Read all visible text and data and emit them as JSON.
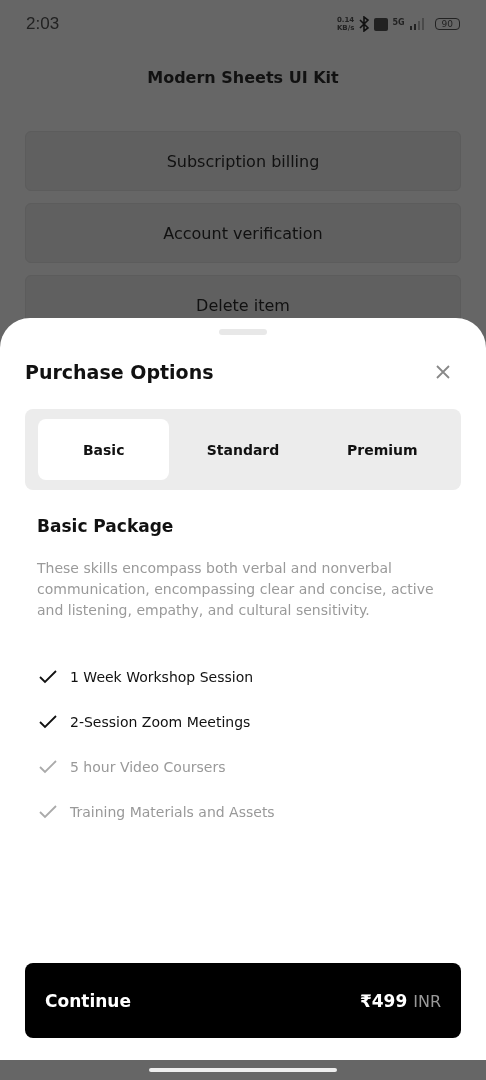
{
  "status_bar": {
    "time": "2:03",
    "speed": "0.14",
    "speed_unit": "KB/s",
    "network": "5G",
    "battery": "90"
  },
  "page": {
    "title": "Modern Sheets UI Kit",
    "items": [
      "Subscription billing",
      "Account verification",
      "Delete item"
    ]
  },
  "sheet": {
    "title": "Purchase Options",
    "tabs": [
      {
        "label": "Basic",
        "selected": true
      },
      {
        "label": "Standard",
        "selected": false
      },
      {
        "label": "Premium",
        "selected": false
      }
    ],
    "package_title": "Basic Package",
    "description": "These skills encompass both verbal and nonverbal communication, encompassing clear and concise, active and listening, empathy, and cultural sensitivity.",
    "features": [
      {
        "label": "1 Week Workshop Session",
        "checked": true
      },
      {
        "label": "2-Session Zoom Meetings",
        "checked": true
      },
      {
        "label": "5 hour Video Coursers",
        "checked": false
      },
      {
        "label": "Training Materials and Assets",
        "checked": false
      }
    ],
    "button": {
      "label": "Continue",
      "price": "₹499",
      "currency": "INR"
    }
  }
}
